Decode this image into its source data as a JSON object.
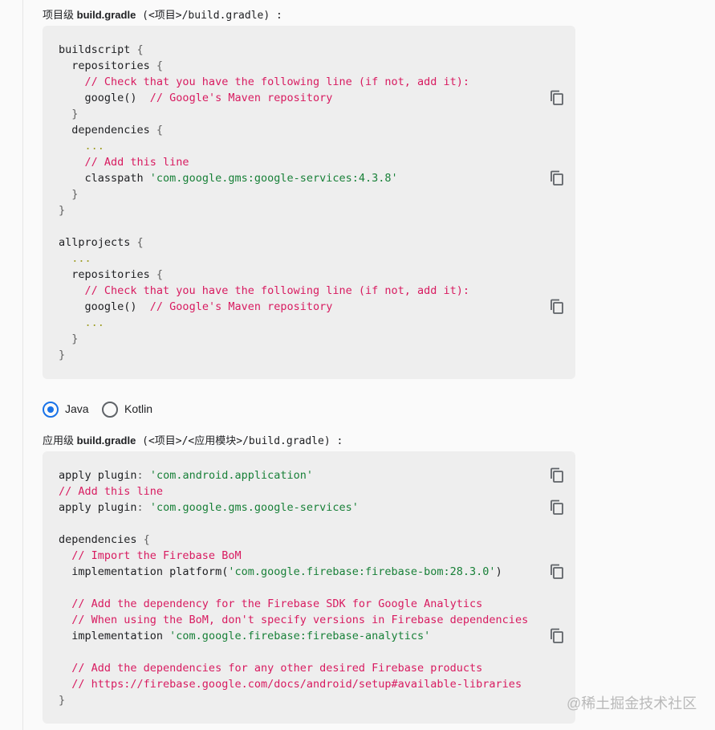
{
  "project_label": {
    "prefix": "项目级 ",
    "name": "build.gradle",
    "path": " (<项目>/build.gradle) :"
  },
  "project_code": [
    [
      [
        "pln",
        "buildscript "
      ],
      [
        "pun",
        "{"
      ]
    ],
    [
      [
        "pln",
        "  repositories "
      ],
      [
        "pun",
        "{"
      ]
    ],
    [
      [
        "com",
        "    // Check that you have the following line (if not, add it):"
      ]
    ],
    [
      [
        "pln",
        "    google()  "
      ],
      [
        "com",
        "// Google's Maven repository"
      ]
    ],
    [
      [
        "pun",
        "  }"
      ]
    ],
    [
      [
        "pln",
        "  dependencies "
      ],
      [
        "pun",
        "{"
      ]
    ],
    [
      [
        "ell",
        "    ..."
      ]
    ],
    [
      [
        "com",
        "    // Add this line"
      ]
    ],
    [
      [
        "pln",
        "    classpath "
      ],
      [
        "str",
        "'com.google.gms:google-services:4.3.8'"
      ]
    ],
    [
      [
        "pun",
        "  }"
      ]
    ],
    [
      [
        "pun",
        "}"
      ]
    ],
    [],
    [
      [
        "pln",
        "allprojects "
      ],
      [
        "pun",
        "{"
      ]
    ],
    [
      [
        "ell",
        "  ..."
      ]
    ],
    [
      [
        "pln",
        "  repositories "
      ],
      [
        "pun",
        "{"
      ]
    ],
    [
      [
        "com",
        "    // Check that you have the following line (if not, add it):"
      ]
    ],
    [
      [
        "pln",
        "    google()  "
      ],
      [
        "com",
        "// Google's Maven repository"
      ]
    ],
    [
      [
        "ell",
        "    ..."
      ]
    ],
    [
      [
        "pun",
        "  }"
      ]
    ],
    [
      [
        "pun",
        "}"
      ]
    ]
  ],
  "project_copy_lines": [
    3,
    8,
    16
  ],
  "language_options": [
    {
      "label": "Java",
      "selected": true
    },
    {
      "label": "Kotlin",
      "selected": false
    }
  ],
  "app_label": {
    "prefix": "应用级 ",
    "name": "build.gradle",
    "path": " (<项目>/<应用模块>/build.gradle) :"
  },
  "app_code": [
    [
      [
        "pln",
        "apply plugin"
      ],
      [
        "pun",
        ": "
      ],
      [
        "str",
        "'com.android.application'"
      ]
    ],
    [
      [
        "com",
        "// Add this line"
      ]
    ],
    [
      [
        "pln",
        "apply plugin"
      ],
      [
        "pun",
        ": "
      ],
      [
        "str",
        "'com.google.gms.google-services'"
      ]
    ],
    [],
    [
      [
        "pln",
        "dependencies "
      ],
      [
        "pun",
        "{"
      ]
    ],
    [
      [
        "com",
        "  // Import the Firebase BoM"
      ]
    ],
    [
      [
        "pln",
        "  implementation platform("
      ],
      [
        "str",
        "'com.google.firebase:firebase-bom:28.3.0'"
      ],
      [
        "pln",
        ")"
      ]
    ],
    [],
    [
      [
        "com",
        "  // Add the dependency for the Firebase SDK for Google Analytics"
      ]
    ],
    [
      [
        "com",
        "  // When using the BoM, don't specify versions in Firebase dependencies"
      ]
    ],
    [
      [
        "pln",
        "  implementation "
      ],
      [
        "str",
        "'com.google.firebase:firebase-analytics'"
      ]
    ],
    [],
    [
      [
        "com",
        "  // Add the dependencies for any other desired Firebase products"
      ]
    ],
    [
      [
        "com",
        "  // https://firebase.google.com/docs/android/setup#available-libraries"
      ]
    ],
    [
      [
        "pun",
        "}"
      ]
    ]
  ],
  "app_copy_lines": [
    0,
    2,
    6,
    10
  ],
  "watermark": "@稀土掘金技术社区",
  "icons": {
    "copy": "content-copy-icon"
  },
  "colors": {
    "comment": "#d81b60",
    "string": "#188038",
    "ellipsis": "#9e9d24",
    "radio_active": "#1a73e8",
    "code_bg": "#eeeeee"
  }
}
